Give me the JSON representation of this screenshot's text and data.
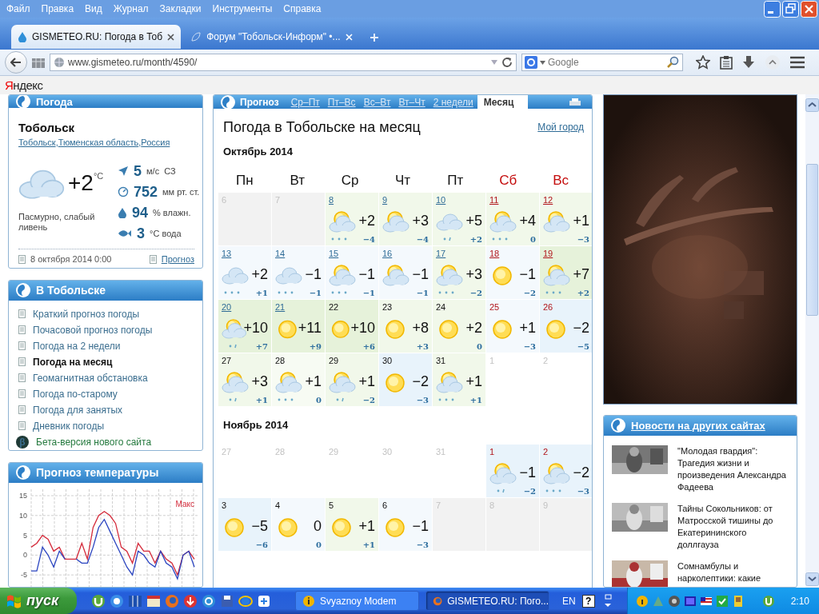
{
  "menu_bar": [
    "Файл",
    "Правка",
    "Вид",
    "Журнал",
    "Закладки",
    "Инструменты",
    "Справка"
  ],
  "tabs": [
    {
      "title": "GISMETEO.RU: Погода в Тоб",
      "selected": true
    },
    {
      "title": "Форум \"Тобольск-Информ\" •...",
      "selected": false
    }
  ],
  "address_bar": {
    "url": "www.gismeteo.ru/month/4590/"
  },
  "search": {
    "placeholder": "Google"
  },
  "yandex_bar": {
    "logo": "Яндекс"
  },
  "current_weather": {
    "header": "Погода",
    "city": "Тобольск",
    "separator": ",",
    "location": [
      "Тобольск",
      "Тюменская область",
      "Россия"
    ],
    "temperature": "+2",
    "unit": "°C",
    "description": "Пасмурно, слабый ливень",
    "stats": [
      {
        "kind": "wind",
        "value": "5",
        "unit": "м/с",
        "extra": "СЗ"
      },
      {
        "kind": "pressure",
        "value": "752",
        "unit": "мм рт. ст."
      },
      {
        "kind": "humidity",
        "value": "94",
        "unit": "% влажн."
      },
      {
        "kind": "water",
        "value": "3",
        "unit": "°C вода"
      }
    ],
    "updated": "8 октября 2014 0:00",
    "forecast_link": "Прогноз"
  },
  "city_links": {
    "header": "В Тобольске",
    "items": [
      {
        "kind": "page",
        "label": "Краткий прогноз погоды",
        "selected": false
      },
      {
        "kind": "page",
        "label": "Почасовой прогноз погоды",
        "selected": false
      },
      {
        "kind": "page",
        "label": "Погода на 2 недели",
        "selected": false
      },
      {
        "kind": "page",
        "label": "Погода на месяц",
        "selected": true
      },
      {
        "kind": "page",
        "label": "Геомагнитная обстановка",
        "selected": false
      },
      {
        "kind": "page",
        "label": "Погода по-старому",
        "selected": false
      },
      {
        "kind": "page",
        "label": "Погода для занятых",
        "selected": false
      },
      {
        "kind": "page",
        "label": "Дневник погоды",
        "selected": false
      },
      {
        "kind": "beta",
        "badge": "β",
        "label": "Бета-версия нового сайта",
        "selected": false
      }
    ]
  },
  "temperature_chart": {
    "header": "Прогноз температуры",
    "chart_data": {
      "type": "line",
      "grid": true,
      "ylim": [
        -8,
        15
      ],
      "yticks": [
        -5,
        0,
        5,
        10,
        15
      ],
      "series": [
        {
          "name": "Макс",
          "color": "#d42a3a",
          "values": [
            2,
            3,
            5,
            4,
            1,
            2,
            -1,
            -1,
            -1,
            3,
            -1,
            7,
            10,
            11,
            10,
            8,
            2,
            1,
            -2,
            3,
            1,
            1,
            -2,
            1,
            -1,
            -2,
            -5,
            0,
            1,
            -1
          ]
        },
        {
          "color": "#2a44c0",
          "values": [
            -4,
            -4,
            2,
            0,
            -3,
            1,
            -1,
            null,
            -1,
            -2,
            -2,
            2,
            7,
            9,
            6,
            3,
            0,
            -3,
            -5,
            1,
            0,
            -2,
            -3,
            1,
            -2,
            -3,
            -6,
            0,
            1,
            -3
          ]
        }
      ]
    }
  },
  "month_forecast": {
    "header": "Прогноз",
    "views": [
      {
        "label": "Ср–Пт",
        "selected": false
      },
      {
        "label": "Пт–Вс",
        "selected": false
      },
      {
        "label": "Вс–Вт",
        "selected": false
      },
      {
        "label": "Вт–Чт",
        "selected": false
      },
      {
        "label": "2 недели",
        "selected": false
      },
      {
        "label": "Месяц",
        "selected": true
      }
    ],
    "title": "Погода в Тобольске на месяц",
    "my_city": "Мой город",
    "weekdays": [
      {
        "label": "Пн",
        "weekend": false
      },
      {
        "label": "Вт",
        "weekend": false
      },
      {
        "label": "Ср",
        "weekend": false
      },
      {
        "label": "Чт",
        "weekend": false
      },
      {
        "label": "Пт",
        "weekend": false
      },
      {
        "label": "Сб",
        "weekend": true
      },
      {
        "label": "Вс",
        "weekend": true
      }
    ],
    "months": [
      {
        "title": "Октябрь 2014",
        "weeks": [
          [
            {
              "date": "6",
              "kind": "past"
            },
            {
              "date": "7",
              "kind": "past"
            },
            {
              "date": "8",
              "kind": "day",
              "link": true,
              "weekend": false,
              "color": "#f1f8ea",
              "icon": {
                "kind": "sun_cloud"
              },
              "precipitation": {
                "kind": "snow"
              },
              "max": "+2",
              "min": "−4"
            },
            {
              "date": "9",
              "kind": "day",
              "link": true,
              "weekend": false,
              "color": "#f1f8ea",
              "icon": {
                "kind": "sun_cloud"
              },
              "max": "+3",
              "min": "−4"
            },
            {
              "date": "10",
              "kind": "day",
              "link": true,
              "weekend": false,
              "color": "#f1f8ea",
              "icon": {
                "kind": "cloud"
              },
              "precipitation": {
                "kind": "rain"
              },
              "max": "+5",
              "min": "+2"
            },
            {
              "date": "11",
              "kind": "day",
              "link": true,
              "weekend": true,
              "color": "#f1f8ea",
              "icon": {
                "kind": "sun_cloud"
              },
              "precipitation": {
                "kind": "snow"
              },
              "max": "+4",
              "min": "0"
            },
            {
              "date": "12",
              "kind": "day",
              "link": true,
              "weekend": true,
              "color": "#f1f8ea",
              "icon": {
                "kind": "sun_cloud"
              },
              "max": "+1",
              "min": "−3"
            }
          ],
          [
            {
              "date": "13",
              "kind": "day",
              "link": true,
              "weekend": false,
              "color": "#f4f9fd",
              "icon": {
                "kind": "cloud"
              },
              "precipitation": {
                "kind": "snow"
              },
              "max": "+2",
              "min": "+1"
            },
            {
              "date": "14",
              "kind": "day",
              "link": true,
              "weekend": false,
              "color": "#f4f9fd",
              "icon": {
                "kind": "cloud"
              },
              "precipitation": {
                "kind": "snow"
              },
              "max": "−1",
              "min": "−1"
            },
            {
              "date": "15",
              "kind": "day",
              "link": true,
              "weekend": false,
              "color": "#f4f9fd",
              "icon": {
                "kind": "sun_cloud"
              },
              "precipitation": {
                "kind": "snow"
              },
              "max": "−1",
              "min": "−1"
            },
            {
              "date": "16",
              "kind": "day",
              "link": true,
              "weekend": false,
              "color": "#f4f9fd",
              "icon": {
                "kind": "sun_cloud"
              },
              "max": "−1",
              "min": "−1"
            },
            {
              "date": "17",
              "kind": "day",
              "link": true,
              "weekend": false,
              "color": "#f1f8ea",
              "icon": {
                "kind": "sun_cloud"
              },
              "precipitation": {
                "kind": "snow"
              },
              "max": "+3",
              "min": "−2"
            },
            {
              "date": "18",
              "kind": "day",
              "link": true,
              "weekend": true,
              "color": "#f4f9fd",
              "icon": {
                "kind": "sun"
              },
              "max": "−1",
              "min": "−2"
            },
            {
              "date": "19",
              "kind": "day",
              "link": true,
              "weekend": true,
              "color": "#e6f2da",
              "icon": {
                "kind": "sun_cloud"
              },
              "precipitation": {
                "kind": "snow"
              },
              "max": "+7",
              "min": "+2"
            }
          ],
          [
            {
              "date": "20",
              "kind": "day",
              "link": true,
              "weekend": false,
              "color": "#e6f2da",
              "icon": {
                "kind": "sun_cloud"
              },
              "precipitation": {
                "kind": "rain"
              },
              "max": "+10",
              "min": "+7"
            },
            {
              "date": "21",
              "kind": "day",
              "link": true,
              "weekend": false,
              "color": "#e6f2da",
              "icon": {
                "kind": "sun"
              },
              "max": "+11",
              "min": "+9"
            },
            {
              "date": "22",
              "kind": "day",
              "link": false,
              "weekend": false,
              "color": "#e6f2da",
              "icon": {
                "kind": "sun"
              },
              "max": "+10",
              "min": "+6"
            },
            {
              "date": "23",
              "kind": "day",
              "link": false,
              "weekend": false,
              "color": "#f1f8ea",
              "icon": {
                "kind": "sun"
              },
              "max": "+8",
              "min": "+3"
            },
            {
              "date": "24",
              "kind": "day",
              "link": false,
              "weekend": false,
              "color": "#f1f8ea",
              "icon": {
                "kind": "sun"
              },
              "max": "+2",
              "min": "0"
            },
            {
              "date": "25",
              "kind": "day",
              "link": false,
              "weekend": true,
              "color": "#f4f9fd",
              "icon": {
                "kind": "sun"
              },
              "max": "+1",
              "min": "−3"
            },
            {
              "date": "26",
              "kind": "day",
              "link": false,
              "weekend": true,
              "color": "#e8f3fb",
              "icon": {
                "kind": "sun"
              },
              "max": "−2",
              "min": "−5"
            }
          ],
          [
            {
              "date": "27",
              "kind": "day",
              "link": false,
              "weekend": false,
              "color": "#f1f8ea",
              "icon": {
                "kind": "sun_cloud"
              },
              "precipitation": {
                "kind": "rain"
              },
              "max": "+3",
              "min": "+1"
            },
            {
              "date": "28",
              "kind": "day",
              "link": false,
              "weekend": false,
              "color": "#f7fbf3",
              "icon": {
                "kind": "sun_cloud"
              },
              "precipitation": {
                "kind": "snow"
              },
              "max": "+1",
              "min": "0"
            },
            {
              "date": "29",
              "kind": "day",
              "link": false,
              "weekend": false,
              "color": "#f1f8ea",
              "icon": {
                "kind": "sun_cloud"
              },
              "precipitation": {
                "kind": "rain"
              },
              "max": "+1",
              "min": "−2"
            },
            {
              "date": "30",
              "kind": "day",
              "link": false,
              "weekend": false,
              "color": "#e8f3fb",
              "icon": {
                "kind": "sun"
              },
              "max": "−2",
              "min": "−3"
            },
            {
              "date": "31",
              "kind": "day",
              "link": false,
              "weekend": false,
              "color": "#f1f8ea",
              "icon": {
                "kind": "sun_cloud"
              },
              "precipitation": {
                "kind": "snow"
              },
              "max": "+1",
              "min": "+1"
            },
            {
              "date": "1",
              "kind": "other"
            },
            {
              "date": "2",
              "kind": "other"
            }
          ]
        ]
      },
      {
        "title": "Ноябрь 2014",
        "weeks": [
          [
            {
              "date": "27",
              "kind": "other"
            },
            {
              "date": "28",
              "kind": "other"
            },
            {
              "date": "29",
              "kind": "other"
            },
            {
              "date": "30",
              "kind": "other"
            },
            {
              "date": "31",
              "kind": "other"
            },
            {
              "date": "1",
              "kind": "day",
              "link": false,
              "weekend": true,
              "color": "#e8f3fb",
              "icon": {
                "kind": "sun_cloud"
              },
              "precipitation": {
                "kind": "rain"
              },
              "max": "−1",
              "min": "−2"
            },
            {
              "date": "2",
              "kind": "day",
              "link": false,
              "weekend": true,
              "color": "#e8f3fb",
              "icon": {
                "kind": "sun_cloud"
              },
              "precipitation": {
                "kind": "snow"
              },
              "max": "−2",
              "min": "−3"
            }
          ],
          [
            {
              "date": "3",
              "kind": "day",
              "link": false,
              "weekend": false,
              "color": "#e8f3fb",
              "icon": {
                "kind": "sun"
              },
              "max": "−5",
              "min": "−6"
            },
            {
              "date": "4",
              "kind": "day",
              "link": false,
              "weekend": false,
              "color": "#f4f9fd",
              "icon": {
                "kind": "sun"
              },
              "max": "0",
              "min": "0"
            },
            {
              "date": "5",
              "kind": "day",
              "link": false,
              "weekend": false,
              "color": "#f1f8ea",
              "icon": {
                "kind": "sun"
              },
              "max": "+1",
              "min": "+1"
            },
            {
              "date": "6",
              "kind": "day",
              "link": false,
              "weekend": false,
              "color": "#f4f9fd",
              "icon": {
                "kind": "sun"
              },
              "max": "−1",
              "min": "−3"
            },
            {
              "date": "7",
              "kind": "past"
            },
            {
              "date": "8",
              "kind": "past"
            },
            {
              "date": "9",
              "kind": "past"
            }
          ]
        ]
      }
    ]
  },
  "news": {
    "header": "Новости на других сайтах",
    "items": [
      {
        "text": "\"Молодая гвардия\": Трагедия жизни и произведения Александра Фадеева"
      },
      {
        "text": "Тайны Сокольников: от Матросской тишины до Екатерининского доллгауза"
      },
      {
        "text": "Сомнамбулы и нарколептики: какие"
      }
    ]
  },
  "taskbar": {
    "start": "пуск",
    "tasks": [
      {
        "label": "Svyaznoy Modem",
        "selected": false
      },
      {
        "label": "GISMETEO.RU: Пого...",
        "selected": true
      }
    ],
    "language": "EN",
    "help": "?",
    "clock": "2:10"
  }
}
